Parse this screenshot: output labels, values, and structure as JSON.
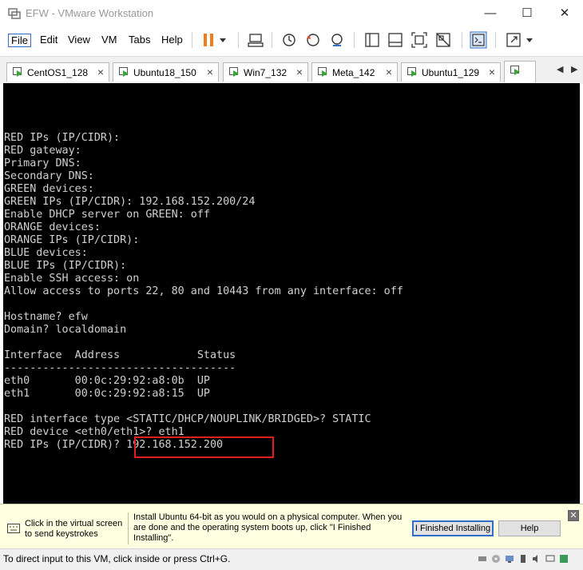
{
  "window": {
    "title": "EFW - VMware Workstation",
    "minimize": "—",
    "maximize": "☐",
    "close": "✕"
  },
  "menu": [
    "File",
    "Edit",
    "View",
    "VM",
    "Tabs",
    "Help"
  ],
  "toolbar": {
    "icons": [
      "pause-icon",
      "dropdown-arrow-icon",
      "send-ctrl-alt-del-icon",
      "snapshot-icon",
      "revert-snapshot-icon",
      "snapshot-manager-icon",
      "library-icon",
      "thumbnail-icon",
      "full-screen-icon",
      "unity-icon",
      "console-view-icon",
      "stretch-icon",
      "dropdown-arrow-icon"
    ]
  },
  "tabs": [
    {
      "label": "CentOS1_128",
      "close": "×"
    },
    {
      "label": "Ubuntu18_150",
      "close": "×"
    },
    {
      "label": "Win7_132",
      "close": "×"
    },
    {
      "label": "Meta_142",
      "close": "×"
    },
    {
      "label": "Ubuntu1_129",
      "close": "×"
    }
  ],
  "tab_nav": {
    "prev": "◀",
    "next": "▶"
  },
  "console": {
    "text": "RED IPs (IP/CIDR):\nRED gateway:\nPrimary DNS:\nSecondary DNS:\nGREEN devices:\nGREEN IPs (IP/CIDR): 192.168.152.200/24\nEnable DHCP server on GREEN: off\nORANGE devices:\nORANGE IPs (IP/CIDR):\nBLUE devices:\nBLUE IPs (IP/CIDR):\nEnable SSH access: on\nAllow access to ports 22, 80 and 10443 from any interface: off\n\nHostname? efw\nDomain? localdomain\n\nInterface  Address            Status\n------------------------------------\neth0       00:0c:29:92:a8:0b  UP\neth1       00:0c:29:92:a8:15  UP\n\nRED interface type <STATIC/DHCP/NOUPLINK/BRIDGED>? STATIC\nRED device <eth0/eth1>? eth1\nRED IPs (IP/CIDR)? 192.168.152.200"
  },
  "hint": {
    "left_text": "Click in the virtual screen to send keystrokes",
    "message": "Install Ubuntu 64-bit as you would on a physical computer. When you are done and the operating system boots up, click \"I Finished Installing\".",
    "finished_button": "I Finished Installing",
    "help_button": "Help",
    "close": "✕"
  },
  "status": {
    "text": "To direct input to this VM, click inside or press Ctrl+G."
  }
}
